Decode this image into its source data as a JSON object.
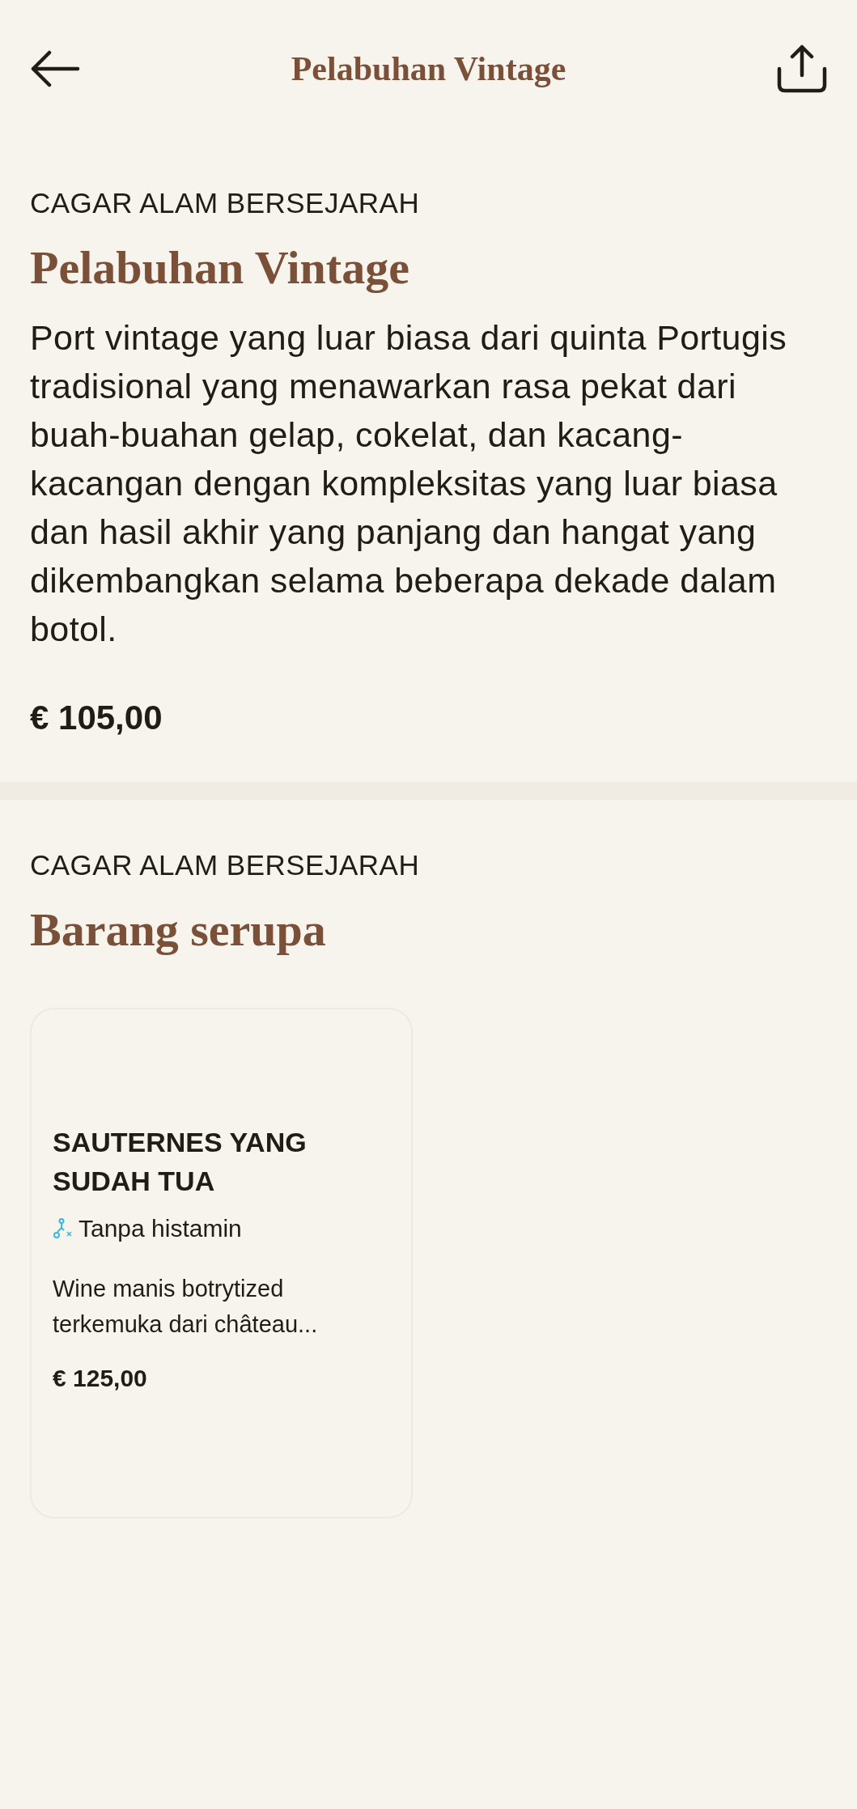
{
  "header": {
    "title": "Pelabuhan Vintage"
  },
  "product": {
    "category": "CAGAR ALAM BERSEJARAH",
    "name": "Pelabuhan Vintage",
    "description": "Port vintage yang luar biasa dari quinta Portugis tradisional yang menawarkan rasa pekat dari buah-buahan gelap, cokelat, dan kacang-kacangan dengan kompleksitas yang luar biasa dan hasil akhir yang panjang dan hangat yang dikembangkan selama beberapa dekade dalam botol.",
    "price": "€ 105,00"
  },
  "similar": {
    "category": "CAGAR ALAM BERSEJARAH",
    "title": "Barang serupa",
    "items": [
      {
        "name": "SAUTERNES YANG SUDAH TUA",
        "tag": "Tanpa histamin",
        "description": "Wine manis botrytized terkemuka dari château...",
        "price": "€ 125,00"
      }
    ]
  }
}
